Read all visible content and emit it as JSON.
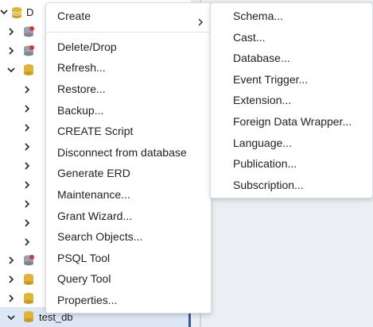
{
  "tree": {
    "top_item_label": "D",
    "selected_item_label": "test_db"
  },
  "menu": {
    "create_label": "Create",
    "items": [
      "Delete/Drop",
      "Refresh...",
      "Restore...",
      "Backup...",
      "CREATE Script",
      "Disconnect from database",
      "Generate ERD",
      "Maintenance...",
      "Grant Wizard...",
      "Search Objects...",
      "PSQL Tool",
      "Query Tool",
      "Properties..."
    ]
  },
  "submenu": {
    "items": [
      "Schema...",
      "Cast...",
      "Database...",
      "Event Trigger...",
      "Extension...",
      "Foreign Data Wrapper...",
      "Language...",
      "Publication...",
      "Subscription..."
    ]
  },
  "colors": {
    "selection": "#dde6f4",
    "accent": "#2c5d9f",
    "db_icon": "#e0b33a",
    "db_error": "#d9363e"
  }
}
